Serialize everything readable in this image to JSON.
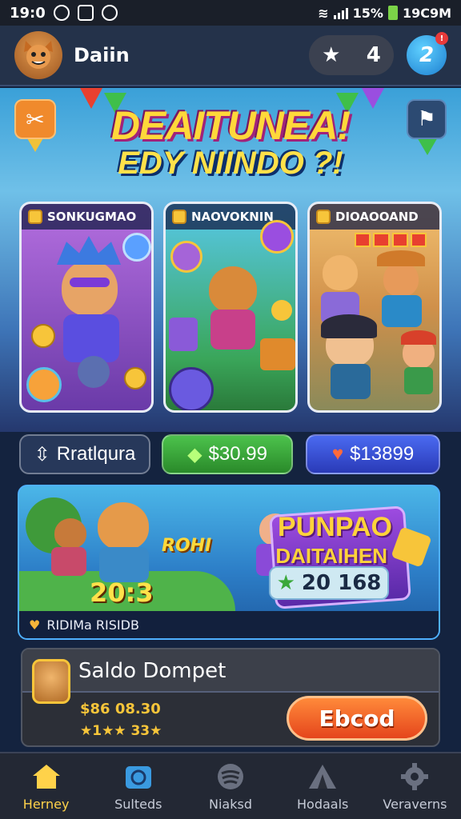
{
  "status_bar": {
    "time": "19:0",
    "right_text": "15%",
    "clock_right": "19C9M"
  },
  "header": {
    "player_name": "Daiin",
    "pill_star": "★",
    "pill_value": "4",
    "level": "2",
    "notif": "!"
  },
  "hero": {
    "title_line1": "DEAITUNEA!",
    "title_line2": "EDY NIINDO ?!",
    "cards": [
      {
        "label": "SONKUGMAO"
      },
      {
        "label": "NAOVOKNIN"
      },
      {
        "label": "DIOAOOAND"
      }
    ]
  },
  "price_buttons": [
    {
      "label": "Rratlqura",
      "icon": "⇳"
    },
    {
      "label": "$30.99",
      "icon": "◆"
    },
    {
      "label": "$13899",
      "icon": "♥"
    }
  ],
  "promo": {
    "rohi": "ROHI",
    "score": "20:3",
    "title_line1": "PUNPAO",
    "title_line2": "DAITAIHEN",
    "stat_value": "20 168",
    "footer_text": "RIDIMa RISIDB"
  },
  "wallet": {
    "title": "Saldo Dompet",
    "amount": "$86 08.30",
    "stars": "★1★★ 33★",
    "claim_label": "Ebcod"
  },
  "nav": [
    {
      "label": "Herney",
      "icon": "home-icon"
    },
    {
      "label": "Sulteds",
      "icon": "camera-icon"
    },
    {
      "label": "Niaksd",
      "icon": "disc-icon"
    },
    {
      "label": "Hodaals",
      "icon": "tent-icon"
    },
    {
      "label": "Veraverns",
      "icon": "gear-icon"
    }
  ],
  "colors": {
    "accent": "#f08a2c",
    "green": "#3aa83a",
    "blue": "#3456d8",
    "bg": "#14233f"
  }
}
